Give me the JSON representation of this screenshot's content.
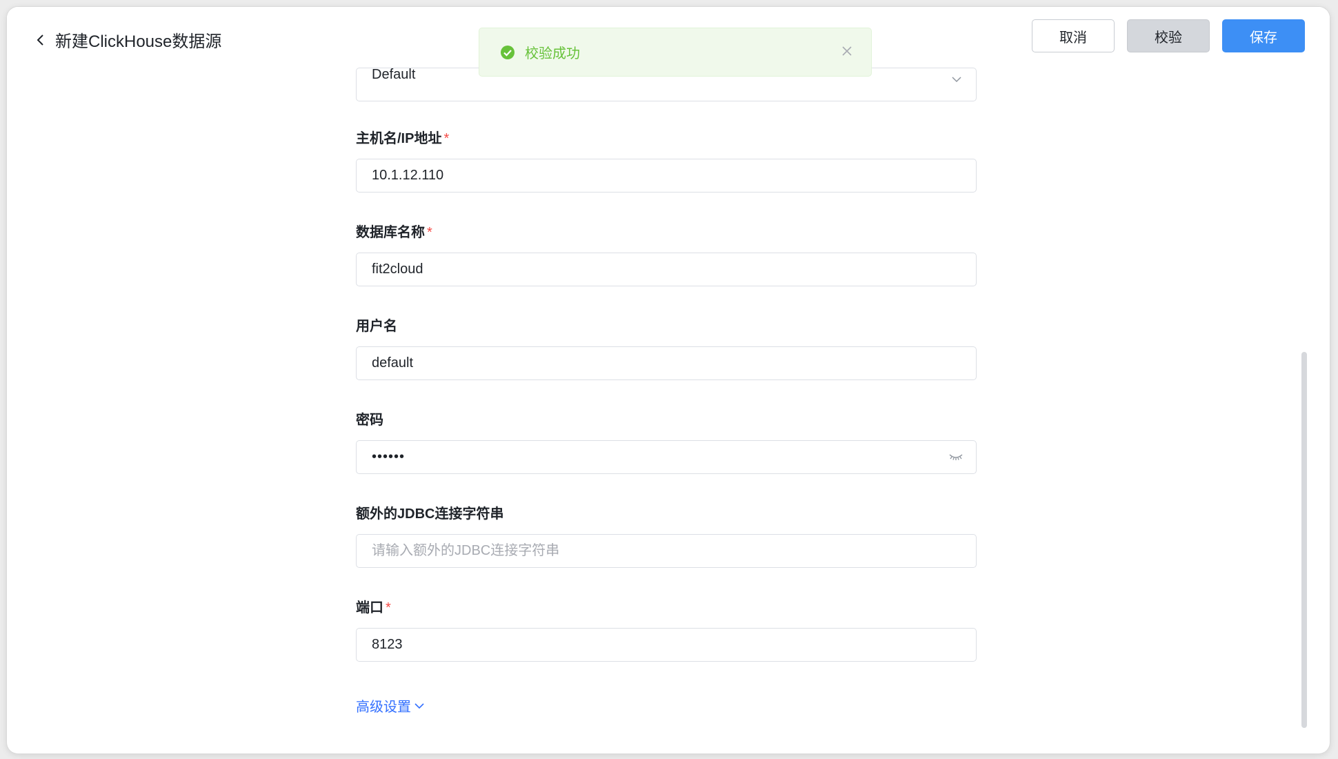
{
  "header": {
    "title": "新建ClickHouse数据源",
    "cancel_label": "取消",
    "verify_label": "校验",
    "save_label": "保存"
  },
  "toast": {
    "message": "校验成功",
    "status_color": "#67c23a"
  },
  "form": {
    "partial_select_value": "Default",
    "fields": [
      {
        "label": "主机名/IP地址",
        "required": "*",
        "value": "10.1.12.110"
      },
      {
        "label": "数据库名称",
        "required": "*",
        "value": "fit2cloud"
      },
      {
        "label": "用户名",
        "value": "default"
      },
      {
        "label": "密码",
        "value": "••••••"
      },
      {
        "label": "额外的JDBC连接字符串",
        "placeholder": "请输入额外的JDBC连接字符串"
      },
      {
        "label": "端口",
        "required": "*",
        "value": "8123"
      }
    ],
    "advanced_label": "高级设置"
  },
  "colors": {
    "primary": "#3d8ff5",
    "link": "#3370ff",
    "required": "#f54a45"
  }
}
